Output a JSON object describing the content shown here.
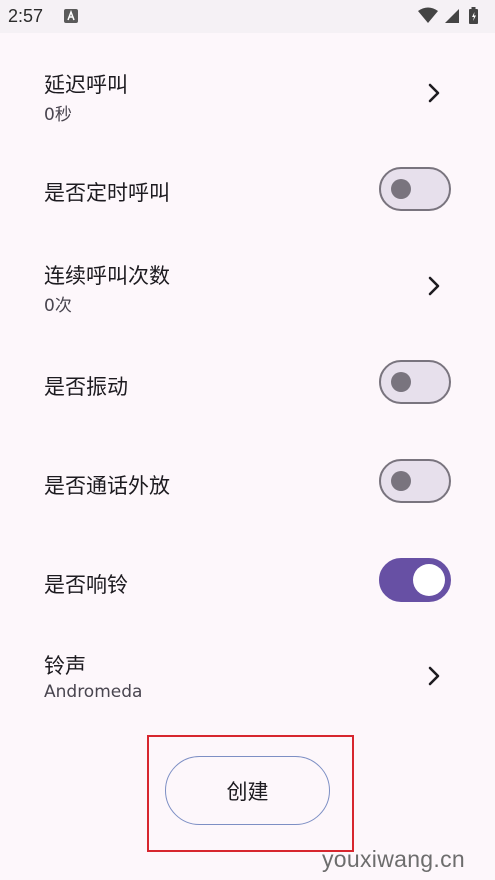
{
  "status_bar": {
    "time": "2:57",
    "icons": [
      "a-notification-icon",
      "wifi-icon",
      "cell-signal-icon",
      "battery-icon"
    ]
  },
  "settings": {
    "delay_call": {
      "title": "延迟呼叫",
      "value": "0秒"
    },
    "scheduled_call": {
      "title": "是否定时呼叫",
      "enabled": false
    },
    "consecutive_calls": {
      "title": "连续呼叫次数",
      "value": "0次"
    },
    "vibrate": {
      "title": "是否振动",
      "enabled": false
    },
    "speakerphone": {
      "title": "是否通话外放",
      "enabled": false
    },
    "ring": {
      "title": "是否响铃",
      "enabled": true
    },
    "ringtone": {
      "title": "铃声",
      "value": "Andromeda"
    }
  },
  "create_button": {
    "label": "创建"
  },
  "watermark": "youxiwang.cn",
  "colors": {
    "background": "#fdf7fb",
    "switch_on": "#6750a4",
    "switch_off_track": "#e7e0ec",
    "switch_off_outline": "#79747e",
    "highlight": "#d7262e",
    "button_outline": "#7d8fc4"
  }
}
